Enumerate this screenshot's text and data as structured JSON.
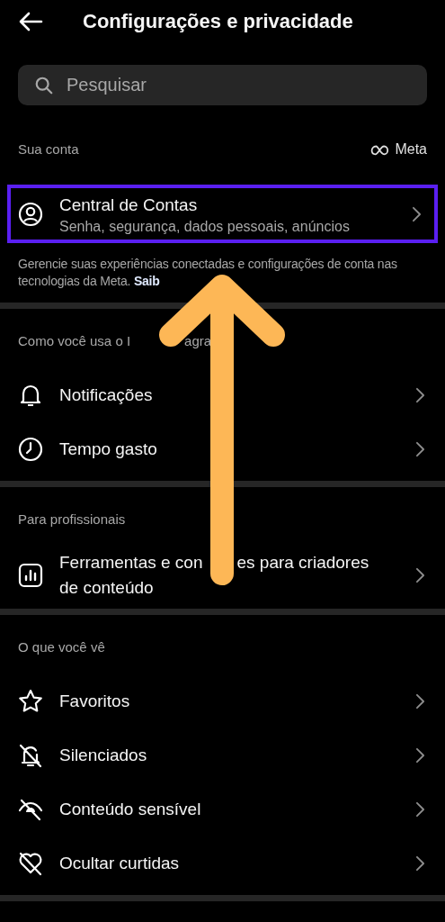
{
  "header": {
    "title": "Configurações e privacidade"
  },
  "search": {
    "placeholder": "Pesquisar"
  },
  "sections": [
    {
      "title": "Sua conta",
      "brand": "Meta",
      "items": [
        {
          "kind": "account",
          "label": "Central de Contas",
          "subtitle": "Senha, segurança, dados pessoais, anúncios",
          "highlighted": true
        }
      ],
      "note": {
        "text": "Gerencie suas experiências conectadas e configurações de conta nas tecnologias da Meta.",
        "link": "Saib"
      }
    },
    {
      "title_parts": [
        "Como você usa o I",
        "agra"
      ],
      "items": [
        {
          "kind": "bell",
          "label": "Notificações",
          "highlighted": false
        },
        {
          "kind": "clock",
          "label": "Tempo gasto",
          "highlighted": false
        }
      ]
    },
    {
      "title": "Para profissionais",
      "items": [
        {
          "kind": "chart",
          "label_parts": [
            "Ferramentas e con",
            "es para criadores"
          ],
          "label_continued": "de conteúdo",
          "highlighted": false
        }
      ]
    },
    {
      "title": "O que você vê",
      "items": [
        {
          "kind": "star",
          "label": "Favoritos",
          "highlighted": false
        },
        {
          "kind": "muted",
          "label": "Silenciados",
          "highlighted": false
        },
        {
          "kind": "sensitive",
          "label": "Conteúdo sensível",
          "highlighted": false
        },
        {
          "kind": "likes",
          "label": "Ocultar curtidas",
          "highlighted": false
        }
      ]
    }
  ]
}
